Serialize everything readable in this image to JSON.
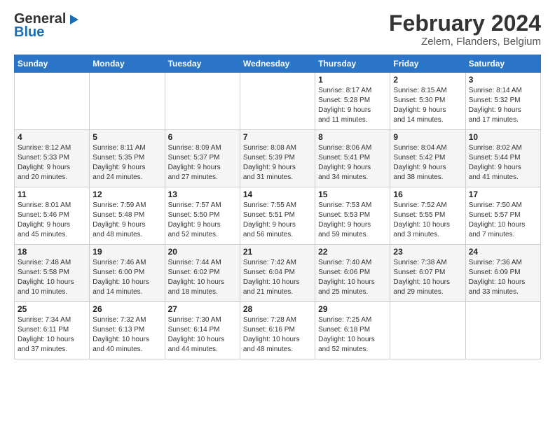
{
  "header": {
    "logo_general": "General",
    "logo_blue": "Blue",
    "month": "February 2024",
    "location": "Zelem, Flanders, Belgium"
  },
  "weekdays": [
    "Sunday",
    "Monday",
    "Tuesday",
    "Wednesday",
    "Thursday",
    "Friday",
    "Saturday"
  ],
  "weeks": [
    [
      {
        "day": "",
        "info": ""
      },
      {
        "day": "",
        "info": ""
      },
      {
        "day": "",
        "info": ""
      },
      {
        "day": "",
        "info": ""
      },
      {
        "day": "1",
        "info": "Sunrise: 8:17 AM\nSunset: 5:28 PM\nDaylight: 9 hours\nand 11 minutes."
      },
      {
        "day": "2",
        "info": "Sunrise: 8:15 AM\nSunset: 5:30 PM\nDaylight: 9 hours\nand 14 minutes."
      },
      {
        "day": "3",
        "info": "Sunrise: 8:14 AM\nSunset: 5:32 PM\nDaylight: 9 hours\nand 17 minutes."
      }
    ],
    [
      {
        "day": "4",
        "info": "Sunrise: 8:12 AM\nSunset: 5:33 PM\nDaylight: 9 hours\nand 20 minutes."
      },
      {
        "day": "5",
        "info": "Sunrise: 8:11 AM\nSunset: 5:35 PM\nDaylight: 9 hours\nand 24 minutes."
      },
      {
        "day": "6",
        "info": "Sunrise: 8:09 AM\nSunset: 5:37 PM\nDaylight: 9 hours\nand 27 minutes."
      },
      {
        "day": "7",
        "info": "Sunrise: 8:08 AM\nSunset: 5:39 PM\nDaylight: 9 hours\nand 31 minutes."
      },
      {
        "day": "8",
        "info": "Sunrise: 8:06 AM\nSunset: 5:41 PM\nDaylight: 9 hours\nand 34 minutes."
      },
      {
        "day": "9",
        "info": "Sunrise: 8:04 AM\nSunset: 5:42 PM\nDaylight: 9 hours\nand 38 minutes."
      },
      {
        "day": "10",
        "info": "Sunrise: 8:02 AM\nSunset: 5:44 PM\nDaylight: 9 hours\nand 41 minutes."
      }
    ],
    [
      {
        "day": "11",
        "info": "Sunrise: 8:01 AM\nSunset: 5:46 PM\nDaylight: 9 hours\nand 45 minutes."
      },
      {
        "day": "12",
        "info": "Sunrise: 7:59 AM\nSunset: 5:48 PM\nDaylight: 9 hours\nand 48 minutes."
      },
      {
        "day": "13",
        "info": "Sunrise: 7:57 AM\nSunset: 5:50 PM\nDaylight: 9 hours\nand 52 minutes."
      },
      {
        "day": "14",
        "info": "Sunrise: 7:55 AM\nSunset: 5:51 PM\nDaylight: 9 hours\nand 56 minutes."
      },
      {
        "day": "15",
        "info": "Sunrise: 7:53 AM\nSunset: 5:53 PM\nDaylight: 9 hours\nand 59 minutes."
      },
      {
        "day": "16",
        "info": "Sunrise: 7:52 AM\nSunset: 5:55 PM\nDaylight: 10 hours\nand 3 minutes."
      },
      {
        "day": "17",
        "info": "Sunrise: 7:50 AM\nSunset: 5:57 PM\nDaylight: 10 hours\nand 7 minutes."
      }
    ],
    [
      {
        "day": "18",
        "info": "Sunrise: 7:48 AM\nSunset: 5:58 PM\nDaylight: 10 hours\nand 10 minutes."
      },
      {
        "day": "19",
        "info": "Sunrise: 7:46 AM\nSunset: 6:00 PM\nDaylight: 10 hours\nand 14 minutes."
      },
      {
        "day": "20",
        "info": "Sunrise: 7:44 AM\nSunset: 6:02 PM\nDaylight: 10 hours\nand 18 minutes."
      },
      {
        "day": "21",
        "info": "Sunrise: 7:42 AM\nSunset: 6:04 PM\nDaylight: 10 hours\nand 21 minutes."
      },
      {
        "day": "22",
        "info": "Sunrise: 7:40 AM\nSunset: 6:06 PM\nDaylight: 10 hours\nand 25 minutes."
      },
      {
        "day": "23",
        "info": "Sunrise: 7:38 AM\nSunset: 6:07 PM\nDaylight: 10 hours\nand 29 minutes."
      },
      {
        "day": "24",
        "info": "Sunrise: 7:36 AM\nSunset: 6:09 PM\nDaylight: 10 hours\nand 33 minutes."
      }
    ],
    [
      {
        "day": "25",
        "info": "Sunrise: 7:34 AM\nSunset: 6:11 PM\nDaylight: 10 hours\nand 37 minutes."
      },
      {
        "day": "26",
        "info": "Sunrise: 7:32 AM\nSunset: 6:13 PM\nDaylight: 10 hours\nand 40 minutes."
      },
      {
        "day": "27",
        "info": "Sunrise: 7:30 AM\nSunset: 6:14 PM\nDaylight: 10 hours\nand 44 minutes."
      },
      {
        "day": "28",
        "info": "Sunrise: 7:28 AM\nSunset: 6:16 PM\nDaylight: 10 hours\nand 48 minutes."
      },
      {
        "day": "29",
        "info": "Sunrise: 7:25 AM\nSunset: 6:18 PM\nDaylight: 10 hours\nand 52 minutes."
      },
      {
        "day": "",
        "info": ""
      },
      {
        "day": "",
        "info": ""
      }
    ]
  ]
}
